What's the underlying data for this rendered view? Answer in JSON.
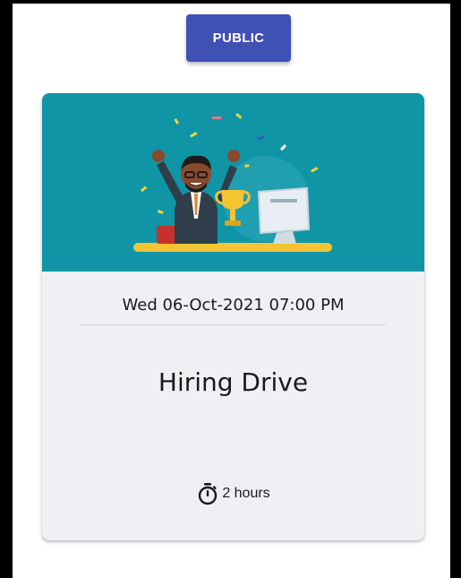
{
  "visibility_button": {
    "label": "PUBLIC"
  },
  "event_card": {
    "date_time": "Wed 06-Oct-2021 07:00 PM",
    "title": "Hiring Drive",
    "duration": "2 hours",
    "duration_icon": "stopwatch-icon",
    "banner_illustration": "celebration-trophy-illustration"
  },
  "colors": {
    "primary": "#3f51b5",
    "banner": "#0f95a6",
    "card_background": "#eff0f4"
  }
}
